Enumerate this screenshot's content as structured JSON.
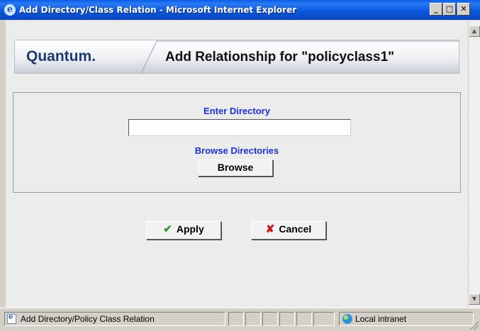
{
  "window": {
    "title": "Add Directory/Class Relation - Microsoft Internet Explorer",
    "minimize_glyph": "_",
    "maximize_glyph": "□",
    "close_glyph": "✕"
  },
  "header": {
    "logo": "Quantum",
    "logo_dot": ".",
    "title": "Add Relationship for \"policyclass1\""
  },
  "form": {
    "directory_label": "Enter Directory",
    "directory_value": "",
    "browse_label": "Browse Directories",
    "browse_button": "Browse"
  },
  "actions": {
    "apply_label": "Apply",
    "apply_icon": "checkmark-icon",
    "cancel_label": "Cancel",
    "cancel_icon": "x-icon"
  },
  "statusbar": {
    "text": "Add Directory/Policy Class Relation",
    "zone": "Local intranet"
  },
  "colors": {
    "titlebar": "#0a58dc",
    "label_blue": "#1b2fe0",
    "logo_navy": "#1d3b73",
    "check_green": "#2a9c2a",
    "cancel_red": "#d01010"
  }
}
